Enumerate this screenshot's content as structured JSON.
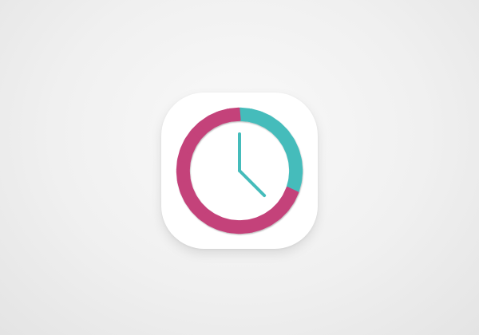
{
  "app_icon": {
    "icon": "clock-icon",
    "total_segments": 36,
    "teal_segments": 11,
    "colors": {
      "pink": "#c4427a",
      "teal": "#45bcbb",
      "face": "#ffffff",
      "hands": "#45bcbb"
    },
    "time": {
      "hour": 3.5,
      "minute": 0
    }
  }
}
